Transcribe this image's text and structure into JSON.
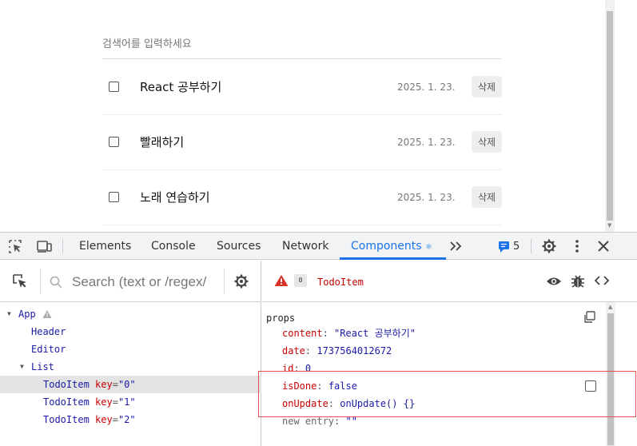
{
  "app": {
    "search_placeholder": "검색어를 입력하세요",
    "delete_label": "삭제",
    "todos": [
      {
        "content": "React 공부하기",
        "date": "2025. 1. 23."
      },
      {
        "content": "빨래하기",
        "date": "2025. 1. 23."
      },
      {
        "content": "노래 연습하기",
        "date": "2025. 1. 23."
      }
    ]
  },
  "devtools": {
    "tabs": [
      "Elements",
      "Console",
      "Sources",
      "Network",
      "Components"
    ],
    "active_tab": "Components",
    "issues_count": "5",
    "tree_search_placeholder": "Search (text or /regex/",
    "tree": [
      {
        "name": "App"
      },
      {
        "name": "Header"
      },
      {
        "name": "Editor"
      },
      {
        "name": "List"
      },
      {
        "name": "TodoItem",
        "key_label": "key",
        "key_value": "\"0\""
      },
      {
        "name": "TodoItem",
        "key_label": "key",
        "key_value": "\"1\""
      },
      {
        "name": "TodoItem",
        "key_label": "key",
        "key_value": "\"2\""
      }
    ],
    "inspector": {
      "badge": "0",
      "component_name": "TodoItem",
      "section_title": "props",
      "props": [
        {
          "key": "content",
          "value": "\"React 공부하기\""
        },
        {
          "key": "date",
          "value": "1737564012672"
        },
        {
          "key": "id",
          "value": "0"
        },
        {
          "key": "isDone",
          "value": "false"
        },
        {
          "key": "onUpdate",
          "value": "onUpdate() {}"
        }
      ],
      "new_entry_label": "new entry",
      "new_entry_value": "\"\""
    }
  },
  "colors": {
    "accent": "#1a73e8",
    "prop_key": "#c80000",
    "prop_value": "#1a1aa6",
    "highlight": "#e05050",
    "warning": "#d93025"
  }
}
